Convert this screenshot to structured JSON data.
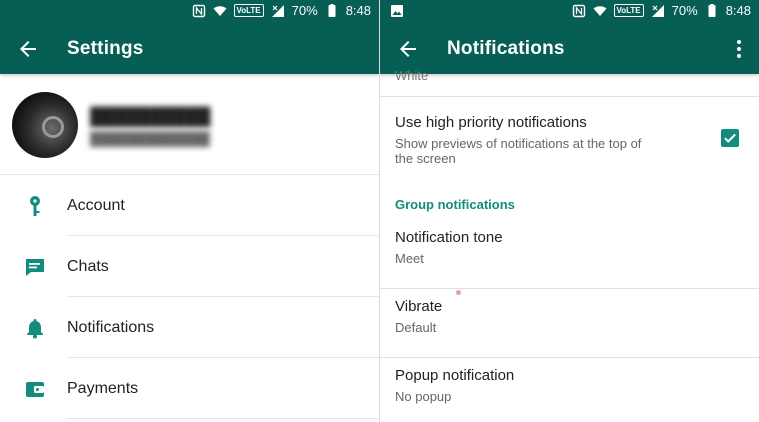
{
  "left": {
    "status": {
      "battery_pct": "70%",
      "time": "8:48",
      "volte": "VoLTE"
    },
    "appbar_title": "Settings",
    "menu": [
      {
        "label": "Account",
        "icon": "key-icon"
      },
      {
        "label": "Chats",
        "icon": "chat-icon"
      },
      {
        "label": "Notifications",
        "icon": "bell-icon"
      },
      {
        "label": "Payments",
        "icon": "wallet-icon"
      }
    ]
  },
  "right": {
    "status": {
      "battery_pct": "70%",
      "time": "8:48",
      "volte": "VoLTE"
    },
    "appbar_title": "Notifications",
    "cut_text": "White",
    "high_priority": {
      "title": "Use high priority notifications",
      "subtitle": "Show previews of notifications at the top of the screen",
      "checked": true
    },
    "group_header": "Group notifications",
    "rows": [
      {
        "title": "Notification tone",
        "value": "Meet"
      },
      {
        "title": "Vibrate",
        "value": "Default"
      },
      {
        "title": "Popup notification",
        "value": "No popup"
      }
    ]
  },
  "colors": {
    "primary_dark": "#075e54",
    "accent": "#128c7e"
  }
}
